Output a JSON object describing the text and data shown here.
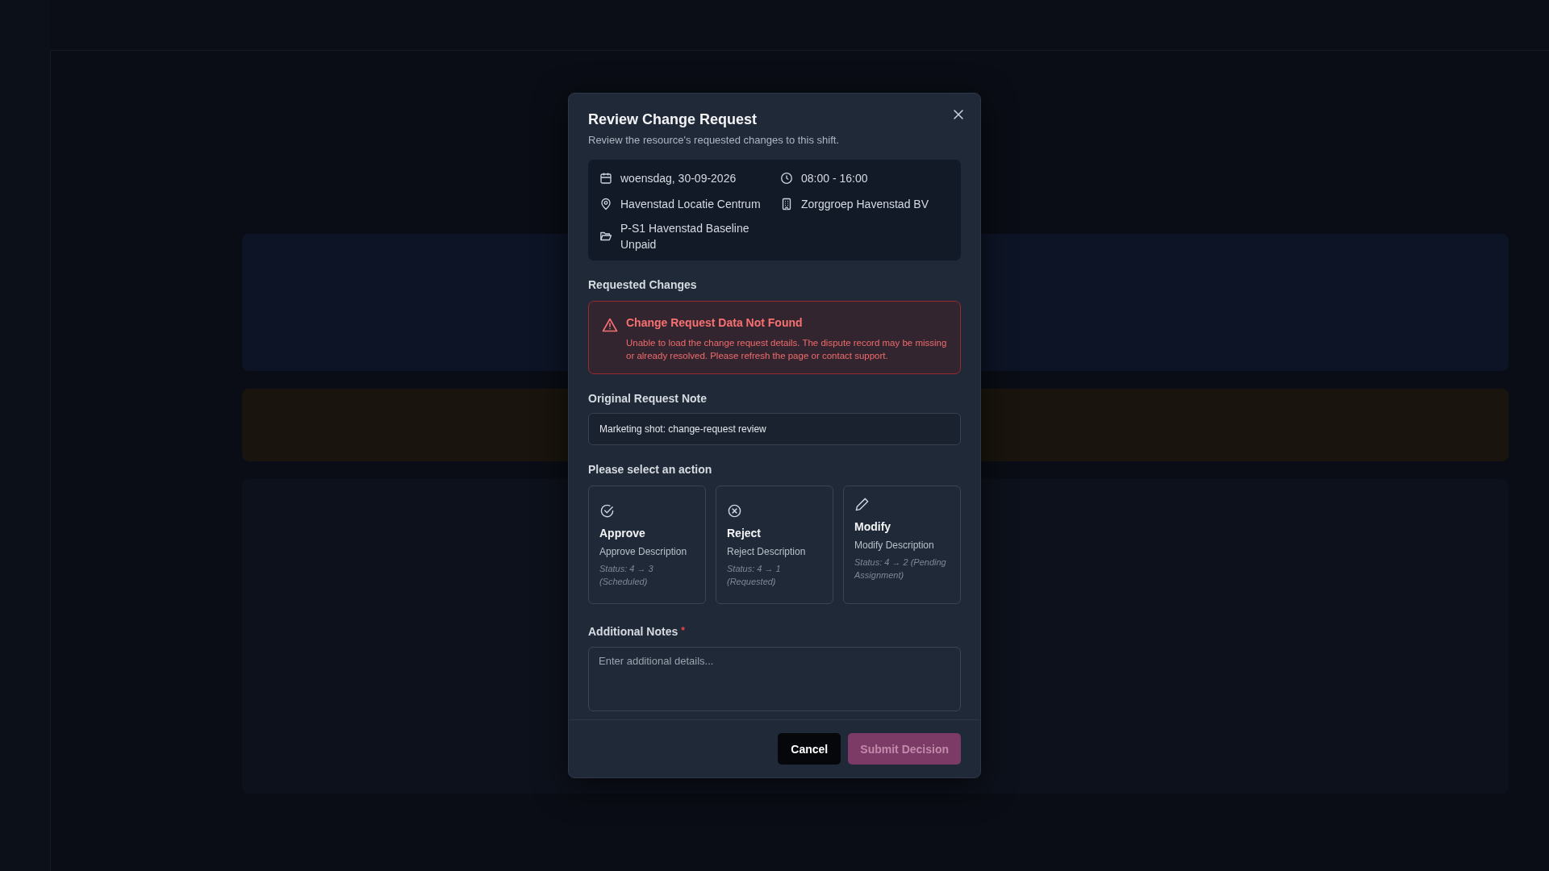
{
  "dialog": {
    "title": "Review Change Request",
    "subtitle": "Review the resource's requested changes to this shift.",
    "details": [
      {
        "kind": "date",
        "text": "woensdag, 30-09-2026"
      },
      {
        "kind": "time",
        "text": "08:00 - 16:00"
      },
      {
        "kind": "location",
        "text": "Havenstad Locatie Centrum"
      },
      {
        "kind": "organization",
        "text": "Zorggroep Havenstad BV"
      },
      {
        "kind": "project",
        "text": "P-S1 Havenstad Baseline Unpaid"
      }
    ],
    "requested_changes": {
      "heading": "Requested Changes",
      "alert": {
        "title": "Change Request Data Not Found",
        "message": "Unable to load the change request details. The dispute record may be missing or already resolved. Please refresh the page or contact support."
      }
    },
    "original_note": {
      "heading": "Original Request Note",
      "text": "Marketing shot: change-request review"
    },
    "action_heading": "Please select an action",
    "actions": [
      {
        "kind": "approve",
        "title": "Approve",
        "description": "Approve Description",
        "status": "Status: 4 → 3 (Scheduled)",
        "selected": false
      },
      {
        "kind": "reject",
        "title": "Reject",
        "description": "Reject Description",
        "status": "Status: 4 → 1 (Requested)",
        "selected": false
      },
      {
        "kind": "modify",
        "title": "Modify",
        "description": "Modify Description",
        "status": "Status: 4 → 2 (Pending Assignment)",
        "selected": false
      }
    ],
    "notes": {
      "label": "Additional Notes",
      "required": true,
      "required_marker": "*",
      "placeholder": "Enter additional details..."
    },
    "buttons": [
      {
        "kind": "secondary",
        "label": "Cancel",
        "disabled": false
      },
      {
        "kind": "primary",
        "label": "Submit Decision",
        "disabled": true
      }
    ]
  }
}
